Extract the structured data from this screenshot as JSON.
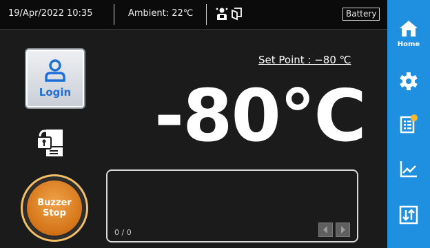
{
  "status_bar": {
    "datetime": "19/Apr/2022  10:35",
    "ambient": "Ambient: 22℃",
    "battery_label": "Battery",
    "status_icons": [
      "person-alarm-icon",
      "door-icon"
    ]
  },
  "sidebar": {
    "items": [
      {
        "name": "home",
        "label": "Home",
        "icon": "house-icon"
      },
      {
        "name": "settings",
        "icon": "gear-icon"
      },
      {
        "name": "alarm-log",
        "icon": "notes-icon"
      },
      {
        "name": "trend",
        "icon": "line-chart-icon"
      },
      {
        "name": "data-transfer",
        "icon": "transfer-icon"
      }
    ]
  },
  "login": {
    "label": "Login"
  },
  "set_point": "Set Point : −80 ℃",
  "temperature": {
    "value": "-80",
    "unit": "℃"
  },
  "buzzer": {
    "line1": "Buzzer",
    "line2": "Stop"
  },
  "messages": {
    "counter": "0 / 0"
  },
  "colors": {
    "sidebar": "#1f8fe0",
    "background": "#1b1b1b",
    "buzzer": "#d6781b",
    "notification_dot": "#f5b82e"
  }
}
